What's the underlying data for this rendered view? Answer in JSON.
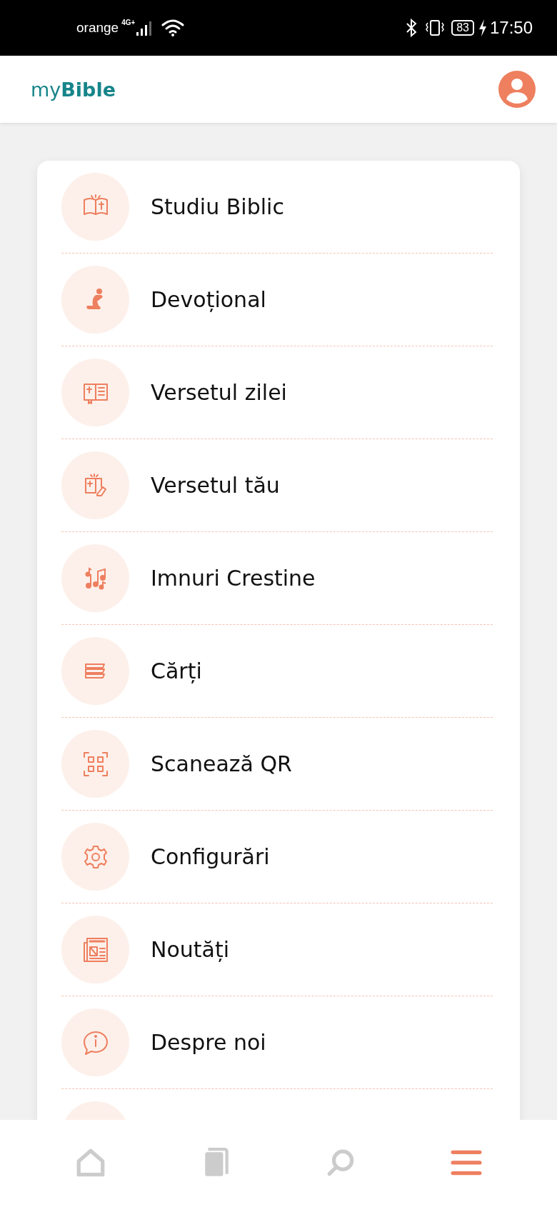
{
  "status_bar": {
    "carrier": "orange",
    "network": "4G+",
    "battery": "83",
    "time": "17:50"
  },
  "header": {
    "logo_light": "my",
    "logo_bold": "Bible"
  },
  "menu": [
    {
      "label": "Studiu Biblic"
    },
    {
      "label": "Devoțional"
    },
    {
      "label": "Versetul zilei"
    },
    {
      "label": "Versetul tău"
    },
    {
      "label": "Imnuri Crestine"
    },
    {
      "label": "Cărți"
    },
    {
      "label": "Scanează QR"
    },
    {
      "label": "Configurări"
    },
    {
      "label": "Noutăți"
    },
    {
      "label": "Despre noi"
    }
  ],
  "bottom_nav": [
    {
      "selected": false
    },
    {
      "selected": false
    },
    {
      "selected": false
    },
    {
      "selected": true
    }
  ]
}
